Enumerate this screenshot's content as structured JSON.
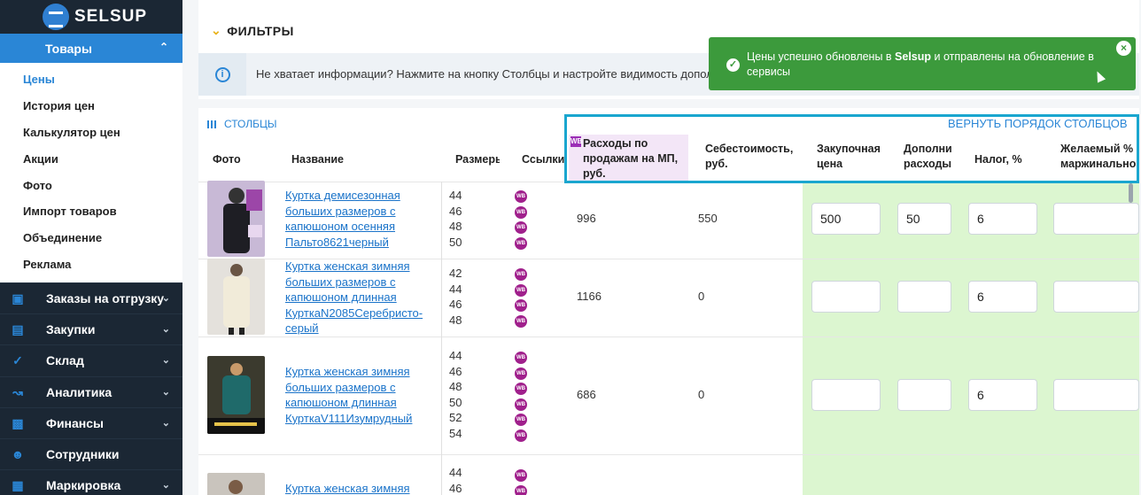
{
  "brand": {
    "name": "SELSUP"
  },
  "sidebar": {
    "active_section": "Товары",
    "submenu": [
      "Цены",
      "История цен",
      "Калькулятор цен",
      "Акции",
      "Фото",
      "Импорт товаров",
      "Объединение",
      "Реклама"
    ],
    "sections": [
      {
        "label": "Заказы на отгрузку",
        "icon": "box-icon"
      },
      {
        "label": "Закупки",
        "icon": "cart-icon"
      },
      {
        "label": "Склад",
        "icon": "check-circle-icon"
      },
      {
        "label": "Аналитика",
        "icon": "chart-icon"
      },
      {
        "label": "Финансы",
        "icon": "wallet-icon"
      },
      {
        "label": "Сотрудники",
        "icon": "user-icon"
      },
      {
        "label": "Маркировка",
        "icon": "scan-icon"
      }
    ]
  },
  "filters": {
    "label": "ФИЛЬТРЫ"
  },
  "info": {
    "text": "Не хватает информации? Нажмите на кнопку Столбцы и настройте видимость дополните"
  },
  "table": {
    "columns_button": "СТОЛБЦЫ",
    "reset_link": "ВЕРНУТЬ ПОРЯДОК СТОЛБЦОВ",
    "headers": {
      "photo": "Фото",
      "name": "Название",
      "sizes": "Размеры",
      "links": "Ссылки",
      "mp_expenses": "Расходы по продажам на МП, руб.",
      "cost": "Себестоимость, руб.",
      "purchase": "Закупочная цена",
      "extra": "Дополни расходы",
      "tax": "Налог, %",
      "margin": "Желаемый % маржинально"
    },
    "rows": [
      {
        "name": "Куртка демисезонная больших размеров с капюшоном осенняя Пальто8621черный",
        "sizes": [
          "44",
          "46",
          "48",
          "50"
        ],
        "mp": "996",
        "cost": "550",
        "purchase": "500",
        "extra": "50",
        "tax": "6",
        "margin": ""
      },
      {
        "name": "Куртка женская зимняя больших размеров с капюшоном длинная КурткаN2085Серебристо-серый",
        "sizes": [
          "42",
          "44",
          "46",
          "48"
        ],
        "mp": "1166",
        "cost": "0",
        "purchase": "",
        "extra": "",
        "tax": "6",
        "margin": ""
      },
      {
        "name": "Куртка женская зимняя больших размеров с капюшоном длинная КурткаV111Изумрудный",
        "sizes": [
          "44",
          "46",
          "48",
          "50",
          "52",
          "54"
        ],
        "mp": "686",
        "cost": "0",
        "purchase": "",
        "extra": "",
        "tax": "6",
        "margin": ""
      },
      {
        "name": "Куртка женская зимняя",
        "sizes": [
          "44",
          "46"
        ],
        "mp": "",
        "cost": "",
        "purchase": "",
        "extra": "",
        "tax": "",
        "margin": ""
      }
    ]
  },
  "toast": {
    "message_prefix": "Цены успешно обновлены в ",
    "message_brand": "Selsup",
    "message_suffix": " и отправлены на обновление в сервисы"
  },
  "marketplace_badge": "WB",
  "colors": {
    "accent": "#2a86d6",
    "sidebar_bg": "#1b2734",
    "toast_bg": "#3c9a3c",
    "highlight": "#1aa6cf",
    "editable_bg": "#dcf6d0"
  }
}
